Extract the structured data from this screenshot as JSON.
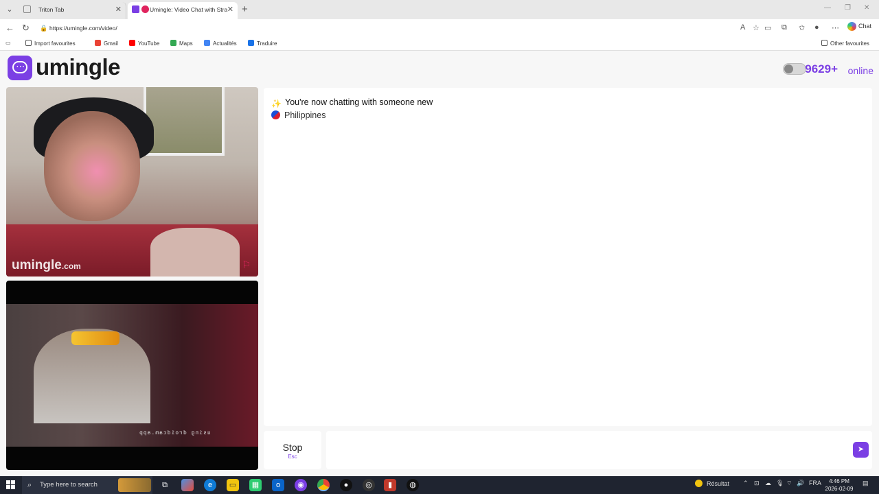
{
  "browser": {
    "tabs": [
      {
        "label": "Triton Tab"
      },
      {
        "label": "Umingle: Video Chat with Stra"
      }
    ],
    "url": "https://umingle.com/video/",
    "chat_label": "Chat",
    "bookmarks": [
      {
        "label": "Import favourites"
      },
      {
        "label": "Gmail"
      },
      {
        "label": "YouTube"
      },
      {
        "label": "Maps"
      },
      {
        "label": "Actualités"
      },
      {
        "label": "Traduire"
      }
    ],
    "other_favourites": "Other favourites"
  },
  "header": {
    "logo_text": "umingle",
    "online_count": "9629+",
    "online_label": "online"
  },
  "video": {
    "watermark_brand": "umingle",
    "watermark_domain": ".com",
    "self_caption": "using droidcam.app"
  },
  "chat": {
    "messages": [
      {
        "text": "You're now chatting with someone new"
      },
      {
        "text": "Philippines"
      }
    ]
  },
  "controls": {
    "stop_label": "Stop",
    "stop_key": "Esc",
    "message_placeholder": ""
  },
  "taskbar": {
    "search_placeholder": "Type here to search",
    "weather_label": "Résultat",
    "language": "FRA",
    "time": "4:46 PM",
    "date": "2026-02-09"
  },
  "colors": {
    "brand": "#7b3fe4",
    "report": "#e0245e"
  }
}
